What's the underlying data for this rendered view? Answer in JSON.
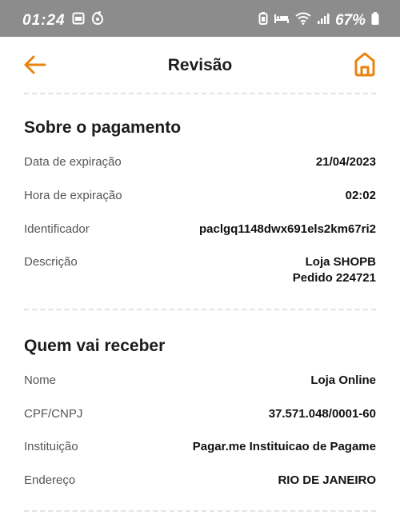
{
  "status_bar": {
    "time": "01:24",
    "battery": "67%"
  },
  "header": {
    "title": "Revisão",
    "accent_color": "#e8830f"
  },
  "payment_section": {
    "title": "Sobre o pagamento",
    "rows": [
      {
        "label": "Data de expiração",
        "value": "21/04/2023"
      },
      {
        "label": "Hora de expiração",
        "value": "02:02"
      },
      {
        "label": "Identificador",
        "value": "paclgq1148dwx691els2km67ri2"
      },
      {
        "label": "Descrição",
        "value_line1": "Loja SHOPB",
        "value_line2": "Pedido 224721"
      }
    ]
  },
  "receiver_section": {
    "title": "Quem vai receber",
    "rows": [
      {
        "label": "Nome",
        "value": "Loja Online"
      },
      {
        "label": "CPF/CNPJ",
        "value": "37.571.048/0001-60"
      },
      {
        "label": "Instituição",
        "value": "Pagar.me Instituicao de Pagame"
      },
      {
        "label": "Endereço",
        "value": "RIO DE JANEIRO"
      }
    ]
  }
}
